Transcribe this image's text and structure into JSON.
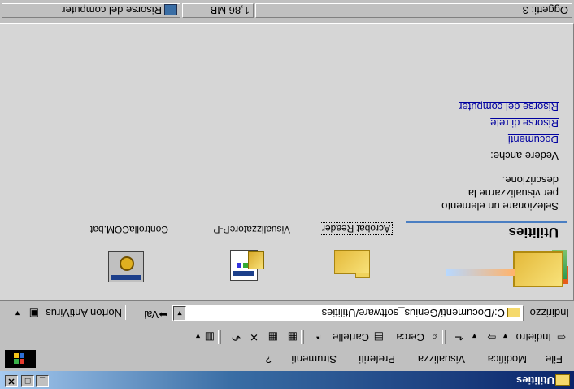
{
  "window": {
    "title": "Utilities",
    "minimize": "_",
    "maximize": "□",
    "close": "✕"
  },
  "menu": [
    "File",
    "Modifica",
    "Visualizza",
    "Preferiti",
    "Strumenti",
    "?"
  ],
  "toolbar": {
    "back": "Indietro",
    "search": "Cerca",
    "folders": "Cartelle"
  },
  "address": {
    "label": "Indirizzo",
    "value": "C:/Documenti/Genius_software/Utilities",
    "go": "Vai",
    "norton": "Norton AntiVirus"
  },
  "content": {
    "folder_title": "Utilities",
    "description_lines": [
      "Selezionare un elemento",
      "per visualizzarne la",
      "descrizione."
    ],
    "see_also": "Vedere anche:",
    "links": [
      "Documenti",
      "Risorse di rete",
      "Risorse del computer"
    ]
  },
  "files": [
    {
      "name": "Acrobat Reader",
      "icon": "folder-icon"
    },
    {
      "name": "VisualizzatoreP-P",
      "icon": "installer-icon"
    },
    {
      "name": "ControllaCOM.bat",
      "icon": "batch-file-icon"
    }
  ],
  "status": {
    "objects": "Oggetti: 3",
    "size": "1,86 MB",
    "location": "Risorse del computer"
  }
}
